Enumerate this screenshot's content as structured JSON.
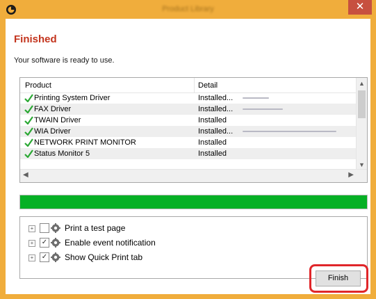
{
  "window": {
    "title": "Product Library",
    "close_glyph": "✕",
    "accent": "#f0ad3c"
  },
  "heading": "Finished",
  "subtitle": "Your software is ready to use.",
  "list": {
    "columns": [
      "Product",
      "Detail"
    ],
    "rows": [
      {
        "product": "Printing System Driver",
        "detail": "Installed...",
        "status_icon": "green-check-icon"
      },
      {
        "product": "FAX Driver",
        "detail": "Installed...",
        "status_icon": "green-check-icon"
      },
      {
        "product": "TWAIN Driver",
        "detail": "Installed",
        "status_icon": "green-check-icon"
      },
      {
        "product": "WIA Driver",
        "detail": "Installed...",
        "status_icon": "green-check-icon"
      },
      {
        "product": "NETWORK PRINT MONITOR",
        "detail": "Installed",
        "status_icon": "green-check-icon"
      },
      {
        "product": "Status Monitor 5",
        "detail": "Installed",
        "status_icon": "green-check-icon"
      }
    ]
  },
  "progress": {
    "fraction": 1.0,
    "color": "#06b025"
  },
  "options": [
    {
      "label": "Print a test page",
      "checked": false
    },
    {
      "label": "Enable event notification",
      "checked": true
    },
    {
      "label": "Show Quick Print tab",
      "checked": true
    }
  ],
  "finish_button": "Finish",
  "highlight_color": "#e0262a"
}
